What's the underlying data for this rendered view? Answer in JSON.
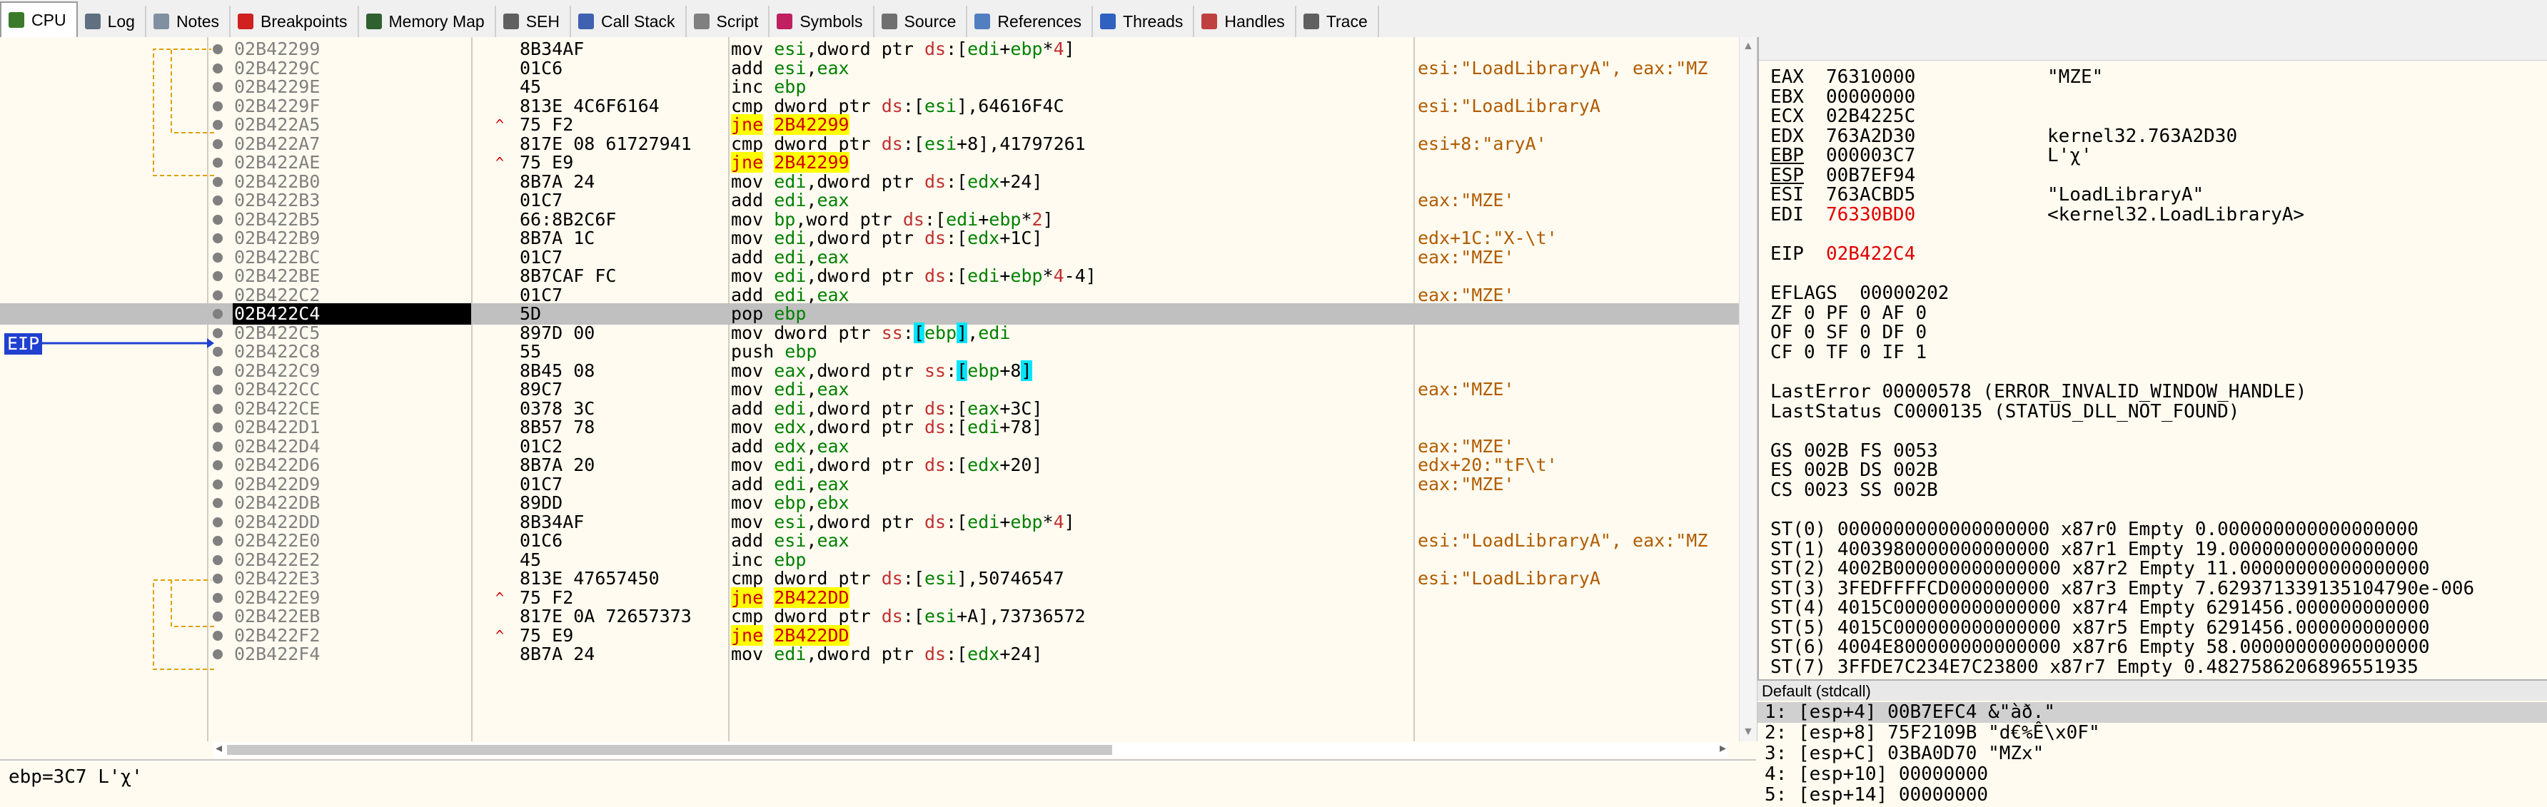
{
  "tabs": [
    {
      "label": "CPU",
      "icon": "cpu-icon",
      "color": "#3a7a2a",
      "active": true
    },
    {
      "label": "Log",
      "icon": "log-icon",
      "color": "#607080"
    },
    {
      "label": "Notes",
      "icon": "notes-icon",
      "color": "#8090a0"
    },
    {
      "label": "Breakpoints",
      "icon": "breakpoint-icon",
      "color": "#d02020"
    },
    {
      "label": "Memory Map",
      "icon": "memory-map-icon",
      "color": "#306030"
    },
    {
      "label": "SEH",
      "icon": "seh-icon",
      "color": "#606060"
    },
    {
      "label": "Call Stack",
      "icon": "call-stack-icon",
      "color": "#4060b0"
    },
    {
      "label": "Script",
      "icon": "script-icon",
      "color": "#808080"
    },
    {
      "label": "Symbols",
      "icon": "symbols-icon",
      "color": "#c02060"
    },
    {
      "label": "Source",
      "icon": "source-icon",
      "color": "#707070"
    },
    {
      "label": "References",
      "icon": "references-icon",
      "color": "#5080c0"
    },
    {
      "label": "Threads",
      "icon": "threads-icon",
      "color": "#3060c0"
    },
    {
      "label": "Handles",
      "icon": "handles-icon",
      "color": "#c04040"
    },
    {
      "label": "Trace",
      "icon": "trace-icon",
      "color": "#606060"
    }
  ],
  "disasm": {
    "eip_label": "EIP",
    "rows": [
      {
        "addr": "02B42299",
        "bytes": "8B34AF",
        "mn": "mov",
        "ops": "esi,dword ptr ds:[edi+ebp*4]",
        "cmt": "",
        "jump": false
      },
      {
        "addr": "02B4229C",
        "bytes": "01C6",
        "mn": "add",
        "ops": "esi,eax",
        "cmt": "esi:\"LoadLibraryA\", eax:\"MZ",
        "jump": false
      },
      {
        "addr": "02B4229E",
        "bytes": "45",
        "mn": "inc",
        "ops": "ebp",
        "cmt": "",
        "jump": false
      },
      {
        "addr": "02B4229F",
        "bytes": "813E 4C6F6164",
        "mn": "cmp",
        "ops": "dword ptr ds:[esi],64616F4C",
        "cmt": "esi:\"LoadLibraryA",
        "jump": false
      },
      {
        "addr": "02B422A5",
        "bytes": "75 F2",
        "mn": "jne",
        "ops": "2B42299",
        "cmt": "",
        "jump": true
      },
      {
        "addr": "02B422A7",
        "bytes": "817E 08 61727941",
        "mn": "cmp",
        "ops": "dword ptr ds:[esi+8],41797261",
        "cmt": "esi+8:\"aryA'",
        "jump": false
      },
      {
        "addr": "02B422AE",
        "bytes": "75 E9",
        "mn": "jne",
        "ops": "2B42299",
        "cmt": "",
        "jump": true
      },
      {
        "addr": "02B422B0",
        "bytes": "8B7A 24",
        "mn": "mov",
        "ops": "edi,dword ptr ds:[edx+24]",
        "cmt": "",
        "jump": false
      },
      {
        "addr": "02B422B3",
        "bytes": "01C7",
        "mn": "add",
        "ops": "edi,eax",
        "cmt": "eax:\"MZE'",
        "jump": false
      },
      {
        "addr": "02B422B5",
        "bytes": "66:8B2C6F",
        "mn": "mov",
        "ops": "bp,word ptr ds:[edi+ebp*2]",
        "cmt": "",
        "jump": false
      },
      {
        "addr": "02B422B9",
        "bytes": "8B7A 1C",
        "mn": "mov",
        "ops": "edi,dword ptr ds:[edx+1C]",
        "cmt": "edx+1C:\"X-\\t'",
        "jump": false
      },
      {
        "addr": "02B422BC",
        "bytes": "01C7",
        "mn": "add",
        "ops": "edi,eax",
        "cmt": "eax:\"MZE'",
        "jump": false
      },
      {
        "addr": "02B422BE",
        "bytes": "8B7CAF FC",
        "mn": "mov",
        "ops": "edi,dword ptr ds:[edi+ebp*4-4]",
        "cmt": "",
        "jump": false
      },
      {
        "addr": "02B422C2",
        "bytes": "01C7",
        "mn": "add",
        "ops": "edi,eax",
        "cmt": "eax:\"MZE'",
        "jump": false
      },
      {
        "addr": "02B422C4",
        "bytes": "5D",
        "mn": "pop",
        "ops": "ebp",
        "cmt": "",
        "jump": false,
        "current": true
      },
      {
        "addr": "02B422C5",
        "bytes": "897D 00",
        "mn": "mov",
        "ops": "dword ptr ss:[ebp],edi",
        "cmt": "",
        "jump": false
      },
      {
        "addr": "02B422C8",
        "bytes": "55",
        "mn": "push",
        "ops": "ebp",
        "cmt": "",
        "jump": false
      },
      {
        "addr": "02B422C9",
        "bytes": "8B45 08",
        "mn": "mov",
        "ops": "eax,dword ptr ss:[ebp+8]",
        "cmt": "",
        "jump": false
      },
      {
        "addr": "02B422CC",
        "bytes": "89C7",
        "mn": "mov",
        "ops": "edi,eax",
        "cmt": "eax:\"MZE'",
        "jump": false
      },
      {
        "addr": "02B422CE",
        "bytes": "0378 3C",
        "mn": "add",
        "ops": "edi,dword ptr ds:[eax+3C]",
        "cmt": "",
        "jump": false
      },
      {
        "addr": "02B422D1",
        "bytes": "8B57 78",
        "mn": "mov",
        "ops": "edx,dword ptr ds:[edi+78]",
        "cmt": "",
        "jump": false
      },
      {
        "addr": "02B422D4",
        "bytes": "01C2",
        "mn": "add",
        "ops": "edx,eax",
        "cmt": "eax:\"MZE'",
        "jump": false
      },
      {
        "addr": "02B422D6",
        "bytes": "8B7A 20",
        "mn": "mov",
        "ops": "edi,dword ptr ds:[edx+20]",
        "cmt": "edx+20:\"tF\\t'",
        "jump": false
      },
      {
        "addr": "02B422D9",
        "bytes": "01C7",
        "mn": "add",
        "ops": "edi,eax",
        "cmt": "eax:\"MZE'",
        "jump": false
      },
      {
        "addr": "02B422DB",
        "bytes": "89DD",
        "mn": "mov",
        "ops": "ebp,ebx",
        "cmt": "",
        "jump": false
      },
      {
        "addr": "02B422DD",
        "bytes": "8B34AF",
        "mn": "mov",
        "ops": "esi,dword ptr ds:[edi+ebp*4]",
        "cmt": "",
        "jump": false
      },
      {
        "addr": "02B422E0",
        "bytes": "01C6",
        "mn": "add",
        "ops": "esi,eax",
        "cmt": "esi:\"LoadLibraryA\", eax:\"MZ",
        "jump": false
      },
      {
        "addr": "02B422E2",
        "bytes": "45",
        "mn": "inc",
        "ops": "ebp",
        "cmt": "",
        "jump": false
      },
      {
        "addr": "02B422E3",
        "bytes": "813E 47657450",
        "mn": "cmp",
        "ops": "dword ptr ds:[esi],50746547",
        "cmt": "esi:\"LoadLibraryA",
        "jump": false
      },
      {
        "addr": "02B422E9",
        "bytes": "75 F2",
        "mn": "jne",
        "ops": "2B422DD",
        "cmt": "",
        "jump": true
      },
      {
        "addr": "02B422EB",
        "bytes": "817E 0A 72657373",
        "mn": "cmp",
        "ops": "dword ptr ds:[esi+A],73736572",
        "cmt": "",
        "jump": false
      },
      {
        "addr": "02B422F2",
        "bytes": "75 E9",
        "mn": "jne",
        "ops": "2B422DD",
        "cmt": "",
        "jump": true
      },
      {
        "addr": "02B422F4",
        "bytes": "8B7A 24",
        "mn": "mov",
        "ops": "edi,dword ptr ds:[edx+24]",
        "cmt": "",
        "jump": false
      }
    ]
  },
  "infobar": {
    "text": "ebp=3C7 L'χ'"
  },
  "registers": {
    "gp": [
      {
        "name": "EAX",
        "value": "76310000",
        "comment": "\"MZE\"",
        "red": false
      },
      {
        "name": "EBX",
        "value": "00000000",
        "comment": "",
        "red": false
      },
      {
        "name": "ECX",
        "value": "02B4225C",
        "comment": "",
        "red": false
      },
      {
        "name": "EDX",
        "value": "763A2D30",
        "comment": "kernel32.763A2D30",
        "red": false
      },
      {
        "name": "EBP",
        "value": "000003C7",
        "comment": "L'χ'",
        "red": false
      },
      {
        "name": "ESP",
        "value": "00B7EF94",
        "comment": "",
        "red": false
      },
      {
        "name": "ESI",
        "value": "763ACBD5",
        "comment": "\"LoadLibraryA\"",
        "red": false
      },
      {
        "name": "EDI",
        "value": "76330BD0",
        "comment": "<kernel32.LoadLibraryA>",
        "red": true
      }
    ],
    "eip": {
      "name": "EIP",
      "value": "02B422C4"
    },
    "eflags": {
      "name": "EFLAGS",
      "value": "00000202"
    },
    "flags": [
      "ZF 0  PF 0  AF 0",
      "OF 0  SF 0  DF 0",
      "CF 0  TF 0  IF 1"
    ],
    "lasterror": "LastError  00000578 (ERROR_INVALID_WINDOW_HANDLE)",
    "laststatus": "LastStatus C0000135 (STATUS_DLL_NOT_FOUND)",
    "segs": [
      "GS 002B  FS 0053",
      "ES 002B  DS 002B",
      "CS 0023  SS 002B"
    ],
    "fpu": [
      "ST(0) 0000000000000000000 x87r0 Empty 0.000000000000000000",
      "ST(1) 4003980000000000000 x87r1 Empty 19.00000000000000000",
      "ST(2) 4002B000000000000000 x87r2 Empty 11.00000000000000000",
      "ST(3) 3FEDFFFFCD000000000 x87r3 Empty 7.629371339135104790e-006",
      "ST(4) 4015C000000000000000 x87r4 Empty 6291456.000000000000",
      "ST(5) 4015C000000000000000 x87r5 Empty 6291456.000000000000",
      "ST(6) 4004E800000000000000 x87r6 Empty 58.00000000000000000",
      "ST(7) 3FFDE7C234E7C23800 x87r7 Empty 0.4827586206896551935"
    ]
  },
  "stack": {
    "header": "Default (stdcall)",
    "rows": [
      "1: [esp+4] 00B7EFC4 &\"àð.\"",
      "2: [esp+8] 75F2109B \"d€%Ê\\x0F\"",
      "3: [esp+C] 03BA0D70 \"MZx\"",
      "4: [esp+10] 00000000",
      "5: [esp+14] 00000000"
    ]
  }
}
